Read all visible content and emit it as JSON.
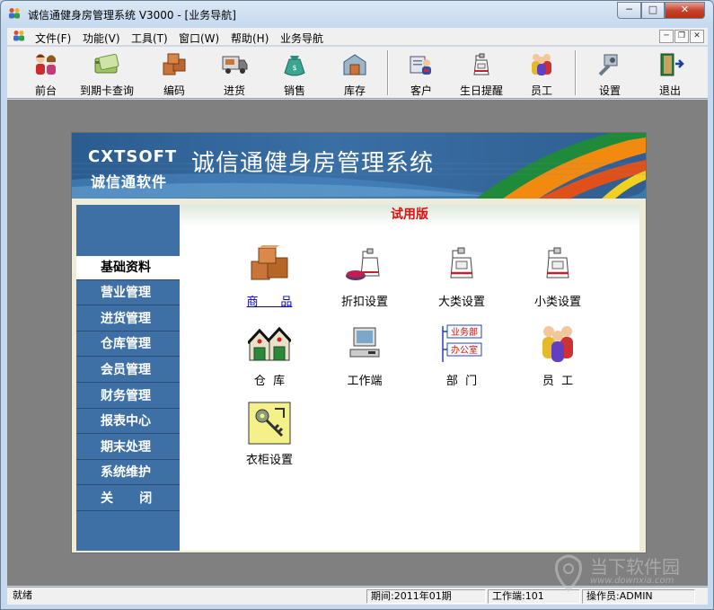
{
  "window": {
    "title": "诚信通健身房管理系统 V3000 - [业务导航]",
    "minimize": "─",
    "maximize": "□",
    "close": "✕"
  },
  "menu": {
    "items": [
      "文件(F)",
      "功能(V)",
      "工具(T)",
      "窗口(W)",
      "帮助(H)",
      "业务导航"
    ],
    "mdi_min": "─",
    "mdi_restore": "❐",
    "mdi_close": "✕"
  },
  "toolbar": {
    "buttons": [
      {
        "label": "前台",
        "icon": "front-desk-icon"
      },
      {
        "label": "到期卡查询",
        "icon": "card-query-icon"
      },
      {
        "label": "编码",
        "icon": "boxes-icon"
      },
      {
        "label": "进货",
        "icon": "truck-icon"
      },
      {
        "label": "销售",
        "icon": "money-bag-icon"
      },
      {
        "label": "库存",
        "icon": "warehouse-icon"
      },
      {
        "label": "客户",
        "icon": "customer-icon"
      },
      {
        "label": "生日提醒",
        "icon": "birthday-icon"
      },
      {
        "label": "员工",
        "icon": "staff-icon"
      },
      {
        "label": "设置",
        "icon": "settings-icon"
      },
      {
        "label": "退出",
        "icon": "exit-icon"
      }
    ]
  },
  "banner": {
    "brand_en": "CXTSOFT",
    "brand_cn": "诚信通软件",
    "system_title": "诚信通健身房管理系统"
  },
  "content": {
    "edition": "试用版"
  },
  "sidebar": {
    "items": [
      {
        "label": "基础资料",
        "active": true
      },
      {
        "label": "营业管理"
      },
      {
        "label": "进货管理"
      },
      {
        "label": "仓库管理"
      },
      {
        "label": "会员管理"
      },
      {
        "label": "财务管理"
      },
      {
        "label": "报表中心"
      },
      {
        "label": "期末处理"
      },
      {
        "label": "系统维护"
      },
      {
        "label": "关      闭"
      }
    ]
  },
  "grid": {
    "items": [
      {
        "label": "商      品",
        "icon": "product-boxes-icon",
        "link": true
      },
      {
        "label": "折扣设置",
        "icon": "discount-icon"
      },
      {
        "label": "大类设置",
        "icon": "category-icon"
      },
      {
        "label": "小类设置",
        "icon": "subcategory-icon"
      },
      {
        "label": "仓  库",
        "icon": "warehouse-house-icon"
      },
      {
        "label": "工作端",
        "icon": "computer-icon"
      },
      {
        "label": "部  门",
        "icon": "department-icon"
      },
      {
        "label": "员  工",
        "icon": "employees-icon"
      },
      {
        "label": "衣柜设置",
        "icon": "locker-key-icon"
      }
    ],
    "department_tags": [
      "业务部",
      "办公室"
    ]
  },
  "statusbar": {
    "ready": "就绪",
    "period": "期间:2011年01期",
    "terminal": "工作端:101",
    "operator": "操作员:ADMIN"
  },
  "watermark": {
    "text": "当下软件园",
    "url": "www.downxia.com"
  },
  "colors": {
    "sidebar": "#3f70a5",
    "trial_text": "#e01010",
    "mdi_background": "#808080",
    "banner": "#2b5c8f"
  }
}
